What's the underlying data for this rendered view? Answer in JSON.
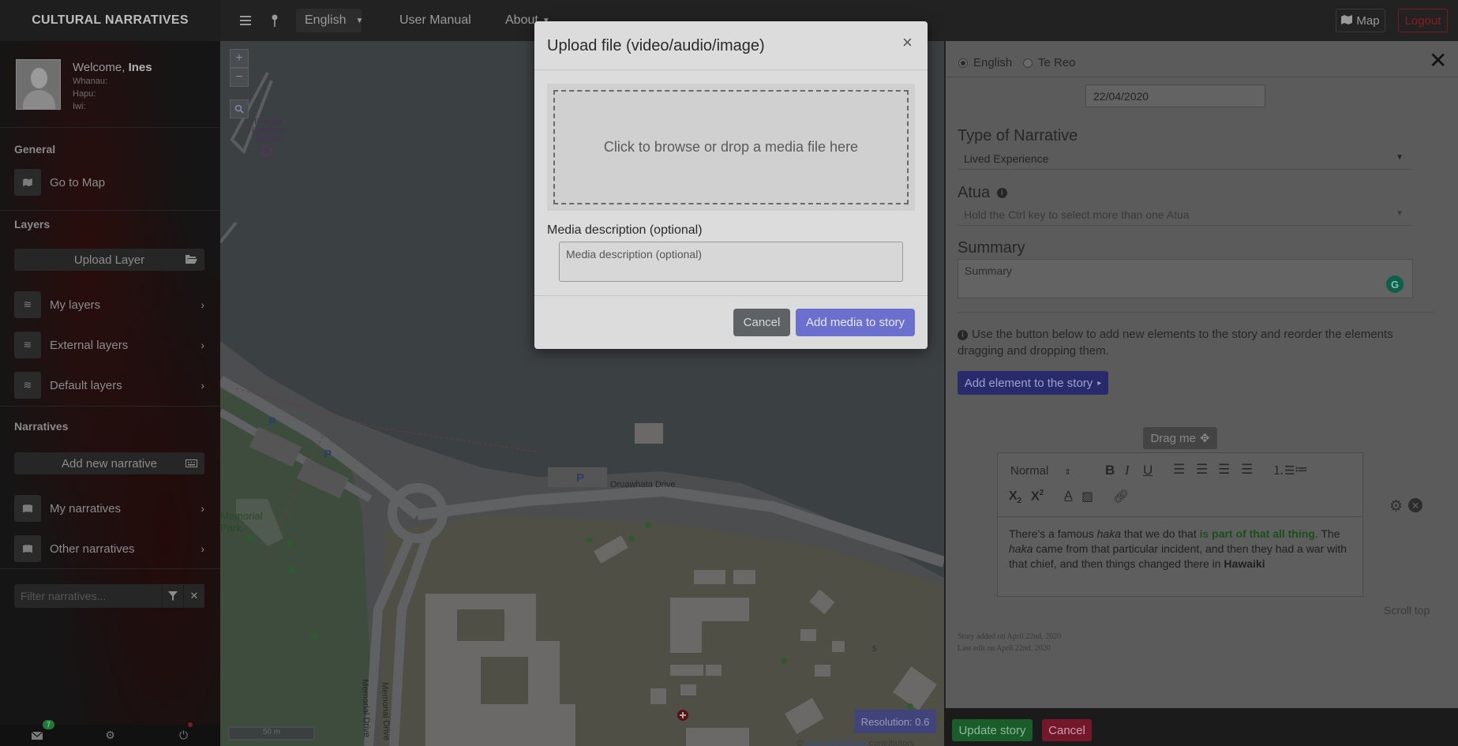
{
  "topbar": {
    "brand": "CULTURAL NARRATIVES",
    "language": "English",
    "user_manual": "User Manual",
    "about": "About",
    "map_label": "Map",
    "logout_label": "Logout"
  },
  "sidebar": {
    "welcome_prefix": "Welcome,",
    "user_name": "Ines",
    "whanau_label": "Whanau:",
    "hapu_label": "Hapu:",
    "iwi_label": "Iwi:",
    "general_title": "General",
    "go_to_map": "Go to Map",
    "layers_title": "Layers",
    "upload_layer": "Upload Layer",
    "my_layers": "My layers",
    "external_layers": "External layers",
    "default_layers": "Default layers",
    "narratives_title": "Narratives",
    "add_new_narrative": "Add new narrative",
    "my_narratives": "My narratives",
    "other_narratives": "Other narratives",
    "filter_placeholder": "Filter narratives...",
    "messages_count": "7"
  },
  "map": {
    "labels": {
      "heliport": "Rotorua Lakefront Heliport",
      "park": "Memorial Park",
      "road1": "Oruawhata Drive",
      "road2": "Memorial Drive",
      "road3": "Memorial Drive",
      "parking": "P",
      "num5": "5"
    },
    "zoom_in": "+",
    "zoom_out": "−",
    "resolution": "Resolution: 0.6",
    "scale": "50 m",
    "attribution_prefix": "©",
    "attribution_link": "OpenStreetMap",
    "attribution_suffix": "contributors"
  },
  "right_panel": {
    "lang_option_1": "English",
    "lang_option_2": "Te Reo",
    "date_value": "22/04/2020",
    "type_label": "Type of Narrative",
    "type_value": "Lived Experience",
    "atua_label": "Atua",
    "atua_placeholder": "Hold the Ctrl key to select more than one Atua",
    "summary_label": "Summary",
    "summary_placeholder": "Summary",
    "hint": "Use the button below to add new elements to the story and reorder the elements dragging and dropping them.",
    "add_element": "Add element to the story",
    "drag_me": "Drag me",
    "editor_format": "Normal",
    "editor_text": {
      "t1": "There's a famous ",
      "t2": "haka",
      "t3": " that we do that ",
      "t4": "is part of that all thing",
      "t5": ". The ",
      "t6": "haka",
      "t7": " came from that particular incident, and then they had a war with that chief, and then things changed there in ",
      "t8": "Hawaiki"
    },
    "scroll_top": "Scroll top",
    "story_added": "Story added on April 22nd, 2020",
    "last_edit": "Last edit on April 22nd, 2020",
    "update_story": "Update story",
    "cancel": "Cancel"
  },
  "modal": {
    "title": "Upload file (video/audio/image)",
    "close": "×",
    "dropzone_text": "Click to browse or drop a media file here",
    "description_label": "Media description (optional)",
    "description_placeholder": "Media description (optional)",
    "cancel": "Cancel",
    "add_media": "Add media to story"
  }
}
